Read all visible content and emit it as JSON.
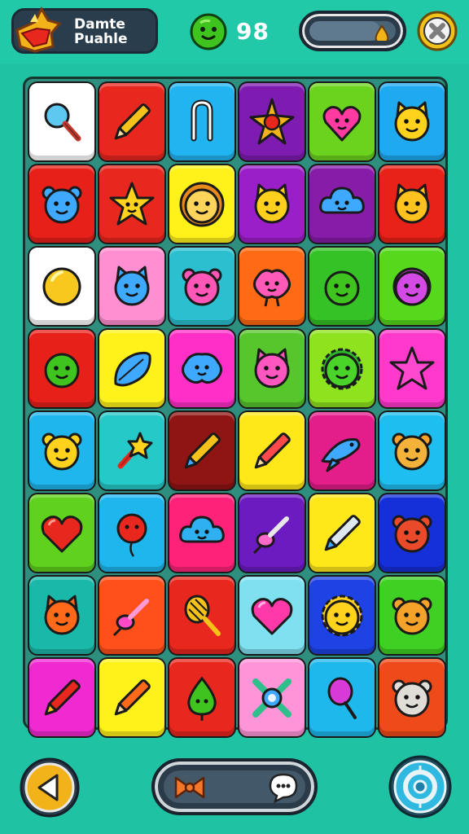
{
  "header": {
    "title_line1": "Damte",
    "title_line2": "Puahle",
    "score": "98",
    "progress_fraction": 0.82,
    "logo_icon": "crown-star-icon",
    "score_icon": "green-face-icon",
    "progress_icon": "gold-drop-icon",
    "close_icon": "close-icon"
  },
  "board": {
    "rows": 8,
    "cols": 6,
    "tiles": [
      [
        {
          "bg": "#ffffff",
          "icon": "magnifier"
        },
        {
          "bg": "#e8271e",
          "icon": "pencil"
        },
        {
          "bg": "#22b4f0",
          "icon": "clip"
        },
        {
          "bg": "#7e1bb0",
          "icon": "star-ball"
        },
        {
          "bg": "#6bd21e",
          "icon": "heart-face"
        },
        {
          "bg": "#1ea9f0",
          "icon": "cat-face"
        }
      ],
      [
        {
          "bg": "#e8201a",
          "icon": "monster-blue"
        },
        {
          "bg": "#e8271e",
          "icon": "star-face"
        },
        {
          "bg": "#fff21a",
          "icon": "lion-face"
        },
        {
          "bg": "#9b1fc9",
          "icon": "fox-face"
        },
        {
          "bg": "#861ca8",
          "icon": "cloud-face"
        },
        {
          "bg": "#e82218",
          "icon": "fox-face-2"
        }
      ],
      [
        {
          "bg": "#ffffff",
          "icon": "gold-ball"
        },
        {
          "bg": "#ff8fd0",
          "icon": "cat-blue"
        },
        {
          "bg": "#2bbfcf",
          "icon": "bear-pink"
        },
        {
          "bg": "#ff6a14",
          "icon": "pink-blob"
        },
        {
          "bg": "#35c226",
          "icon": "green-blob"
        },
        {
          "bg": "#56d81c",
          "icon": "purple-flower"
        }
      ],
      [
        {
          "bg": "#e8201a",
          "icon": "green-ball"
        },
        {
          "bg": "#fff21a",
          "icon": "blue-leaf"
        },
        {
          "bg": "#ff2fc8",
          "icon": "blue-blob"
        },
        {
          "bg": "#57c52c",
          "icon": "pink-cat"
        },
        {
          "bg": "#8fe21e",
          "icon": "green-sun"
        },
        {
          "bg": "#ff39cc",
          "icon": "pink-star"
        }
      ],
      [
        {
          "bg": "#1eb6ec",
          "icon": "yellow-cat"
        },
        {
          "bg": "#25c9c7",
          "icon": "wand"
        },
        {
          "bg": "#8f1414",
          "icon": "pencil-blue"
        },
        {
          "bg": "#ffe81a",
          "icon": "pencil-red"
        },
        {
          "bg": "#e31d8a",
          "icon": "fish"
        },
        {
          "bg": "#1ebef0",
          "icon": "bear-orange"
        }
      ],
      [
        {
          "bg": "#5fd11e",
          "icon": "red-heart"
        },
        {
          "bg": "#1eb6ec",
          "icon": "red-balloon"
        },
        {
          "bg": "#ff2278",
          "icon": "blue-cloud"
        },
        {
          "bg": "#6b1bc0",
          "icon": "pink-brush"
        },
        {
          "bg": "#ffe81a",
          "icon": "pen-blue"
        },
        {
          "bg": "#1530d9",
          "icon": "red-bear"
        }
      ],
      [
        {
          "bg": "#1ab8a8",
          "icon": "orange-fox"
        },
        {
          "bg": "#ff4f1a",
          "icon": "pink-brush-2"
        },
        {
          "bg": "#e8271e",
          "icon": "racket"
        },
        {
          "bg": "#7fe0f0",
          "icon": "pink-heart"
        },
        {
          "bg": "#1e42e3",
          "icon": "sun-face"
        },
        {
          "bg": "#3ed022",
          "icon": "orange-bear"
        }
      ],
      [
        {
          "bg": "#ef2ad0",
          "icon": "red-pencil"
        },
        {
          "bg": "#fff21a",
          "icon": "pen-red"
        },
        {
          "bg": "#e8271e",
          "icon": "green-drop"
        },
        {
          "bg": "#ff94d8",
          "icon": "x-gem"
        },
        {
          "bg": "#1eb8ec",
          "icon": "pink-lolly"
        },
        {
          "bg": "#ef4a1a",
          "icon": "grey-bear"
        }
      ]
    ]
  },
  "footer": {
    "back_icon": "back-arrow-icon",
    "bow_icon": "bow-icon",
    "chat_icon": "chat-bubble-icon",
    "target_icon": "target-icon"
  }
}
